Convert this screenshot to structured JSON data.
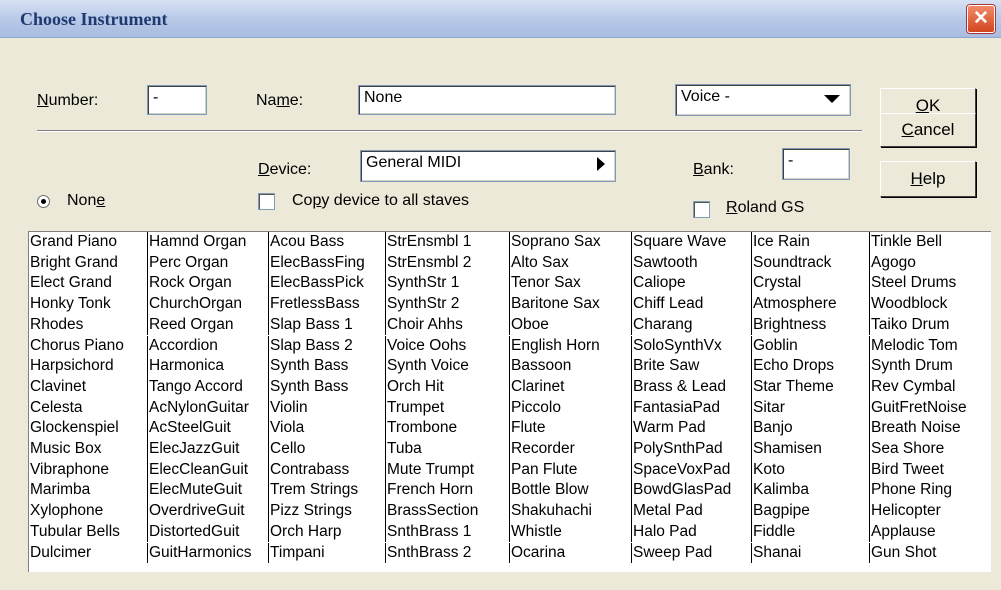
{
  "window": {
    "title": "Choose Instrument",
    "close": "✕"
  },
  "number": {
    "label": "Number:",
    "underline": "N",
    "value": "-"
  },
  "name": {
    "label_pre": "Na",
    "label_u": "m",
    "label_post": "e:",
    "value": "None"
  },
  "voice": {
    "value": "Voice -"
  },
  "buttons": {
    "ok": "OK",
    "ok_u": "O",
    "cancel": "Cancel",
    "cancel_u": "C",
    "help": "Help",
    "help_u": "H"
  },
  "device": {
    "label_u": "D",
    "label_post": "evice:",
    "value": "General MIDI"
  },
  "bank": {
    "label_u": "B",
    "label_post": "ank:",
    "value": "-"
  },
  "none_radio": {
    "label_pre": "Non",
    "label_u": "e"
  },
  "copy_device": {
    "label_pre": "Co",
    "label_u": "p",
    "label_post": "y device to all staves"
  },
  "roland": {
    "label_u": "R",
    "label_post": "oland GS"
  },
  "instruments": [
    [
      "Grand Piano",
      "Bright Grand",
      "Elect Grand",
      "Honky Tonk",
      "Rhodes",
      "Chorus Piano",
      "Harpsichord",
      "Clavinet",
      "Celesta",
      "Glockenspiel",
      "Music Box",
      "Vibraphone",
      "Marimba",
      "Xylophone",
      "Tubular Bells",
      "Dulcimer"
    ],
    [
      "Hamnd Organ",
      "Perc Organ",
      "Rock Organ",
      "ChurchOrgan",
      "Reed Organ",
      "Accordion",
      "Harmonica",
      "Tango Accord",
      "AcNylonGuitar",
      "AcSteelGuit",
      "ElecJazzGuit",
      "ElecCleanGuit",
      "ElecMuteGuit",
      "OverdriveGuit",
      "DistortedGuit",
      "GuitHarmonics"
    ],
    [
      "Acou Bass",
      "ElecBassFing",
      "ElecBassPick",
      "FretlessBass",
      "Slap Bass 1",
      "Slap Bass 2",
      "Synth Bass",
      "Synth Bass",
      "Violin",
      "Viola",
      "Cello",
      "Contrabass",
      "Trem Strings",
      "Pizz Strings",
      "Orch Harp",
      "Timpani"
    ],
    [
      "StrEnsmbl 1",
      "StrEnsmbl 2",
      "SynthStr 1",
      "SynthStr 2",
      "Choir Ahhs",
      "Voice Oohs",
      "Synth Voice",
      "Orch Hit",
      "Trumpet",
      "Trombone",
      "Tuba",
      "Mute Trumpt",
      "French Horn",
      "BrassSection",
      "SnthBrass 1",
      "SnthBrass 2"
    ],
    [
      "Soprano Sax",
      "Alto Sax",
      "Tenor Sax",
      "Baritone Sax",
      "Oboe",
      "English Horn",
      "Bassoon",
      "Clarinet",
      "Piccolo",
      "Flute",
      "Recorder",
      "Pan Flute",
      "Bottle Blow",
      "Shakuhachi",
      "Whistle",
      "Ocarina"
    ],
    [
      "Square Wave",
      "Sawtooth",
      "Caliope",
      "Chiff Lead",
      "Charang",
      "SoloSynthVx",
      "Brite Saw",
      "Brass & Lead",
      "FantasiaPad",
      "Warm Pad",
      "PolySnthPad",
      "SpaceVoxPad",
      "BowdGlasPad",
      "Metal Pad",
      "Halo Pad",
      "Sweep Pad"
    ],
    [
      "Ice Rain",
      "Soundtrack",
      "Crystal",
      "Atmosphere",
      "Brightness",
      "Goblin",
      "Echo Drops",
      "Star Theme",
      "Sitar",
      "Banjo",
      "Shamisen",
      "Koto",
      "Kalimba",
      "Bagpipe",
      "Fiddle",
      "Shanai"
    ],
    [
      "Tinkle Bell",
      "Agogo",
      "Steel Drums",
      "Woodblock",
      "Taiko Drum",
      "Melodic Tom",
      "Synth Drum",
      "Rev Cymbal",
      "GuitFretNoise",
      "Breath Noise",
      "Sea Shore",
      "Bird Tweet",
      "Phone Ring",
      "Helicopter",
      "Applause",
      "Gun Shot"
    ]
  ]
}
